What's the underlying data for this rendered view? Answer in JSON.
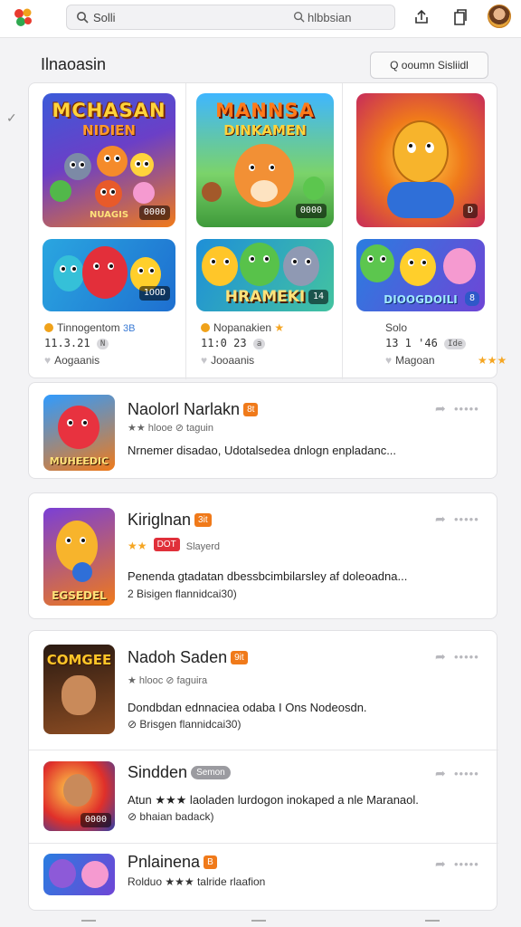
{
  "search": {
    "value": "Solli",
    "placeholder": "hlbbsian"
  },
  "header": {
    "title": "Ilnaoasin",
    "button_label": "Q ooumn Sisliidl"
  },
  "featured": [
    {
      "title_top": "MCHASAN",
      "title_sub": "NIDIEN",
      "art_label": "NUAGIS",
      "chip": "0000",
      "banner_chip": "1OOD",
      "name": "Tinnogentom",
      "badge": "3B",
      "num": "11.3.21",
      "num_badge": "N",
      "sub": "Aogaanis",
      "dot_color": "#f0a21a"
    },
    {
      "title_top": "MANNSA",
      "title_sub": "DINKAMEN",
      "chip": "0000",
      "banner_text": "HRAMEKI",
      "banner_chip": "14",
      "name": "Nopanakien",
      "badge": "★",
      "num": "11:0 23",
      "num_badge": "a",
      "sub": "Jooaanis",
      "dot_color": "#f0a21a"
    },
    {
      "chip": "D",
      "banner_text": "DIOOGDOILI",
      "banner_chip": "8",
      "name": "Solo",
      "num": "13 1 '46",
      "num_badge": "Ide",
      "sub": "Magoan",
      "stars": "★★★"
    }
  ],
  "rows": [
    {
      "name": "Naolorl Narlakn",
      "tag": "8t",
      "sub": "★★ hlooe ⊘ taguin",
      "desc": "Nrnemer disadao, Udotalsedea dnlogn enpladanc...",
      "icon_label": "MUHEEDIC"
    },
    {
      "name": "Kiriglnan",
      "tag": "3it",
      "sub_tag": "DOT",
      "sub": "Slayerd",
      "sub_stars": "★★",
      "desc": "Penenda gtadatan dbessbcimbilarsley af doleoadna...",
      "desc2": "2 Bisigen flannidcai30)",
      "icon_label": "EGSEDEL"
    },
    {
      "name": "Nadoh Saden",
      "tag": "9it",
      "sub": "★ hlooc ⊘ faguira",
      "desc": "Dondbdan ednnaciea odaba I Ons Nodeosdn.",
      "desc2": "⊘ Brisgen flannidcai30)",
      "icon_label": "COMGEE"
    },
    {
      "name": "Sindden",
      "tag": "Semon",
      "desc": "Atun ★★★ laoladen lurdogon inokaped a nle Maranaol.",
      "desc2": "⊘ bhaian badack)",
      "icon_chip": "0000"
    },
    {
      "name": "Pnlainena",
      "tag": "B",
      "desc": "Rolduo ★★★ talride rlaafion"
    }
  ],
  "colors": {
    "accent": "#f07a1a",
    "tag_red": "#e0303a",
    "star": "#f5a623"
  },
  "icons": [
    "app-logo-icon",
    "search-icon",
    "share-icon",
    "copy-icon",
    "avatar",
    "chevron-left-icon",
    "share-arrow-icon",
    "more-dots-icon"
  ]
}
